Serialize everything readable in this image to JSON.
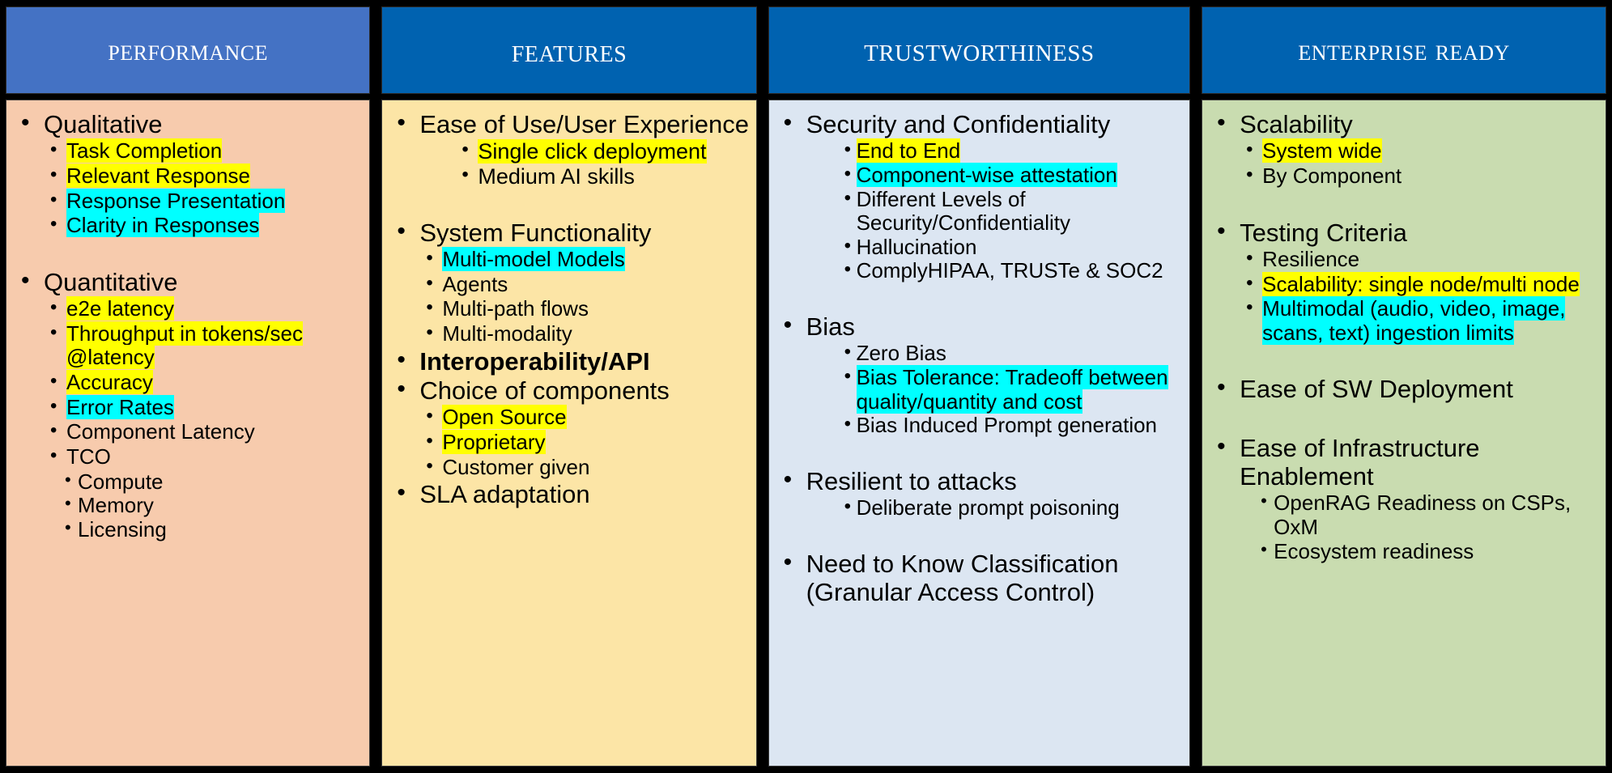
{
  "columns": [
    {
      "id": "performance",
      "title": "PERFORMANCE",
      "header_color": "#4472C4",
      "body_color": "#F7CBAD",
      "items": [
        {
          "level": 1,
          "text": "Qualitative",
          "highlight": "none"
        },
        {
          "level": 2,
          "text": "Task Completion",
          "highlight": "yellow"
        },
        {
          "level": 2,
          "text": " Relevant Response",
          "highlight": "yellow"
        },
        {
          "level": 2,
          "text": "Response  Presentation",
          "highlight": "cyan"
        },
        {
          "level": 2,
          "text": "Clarity in Responses",
          "highlight": "cyan"
        },
        {
          "level": 0,
          "text": "",
          "highlight": "none"
        },
        {
          "level": 1,
          "text": "Quantitative",
          "highlight": "none"
        },
        {
          "level": 2,
          "text": " e2e latency",
          "highlight": "yellow"
        },
        {
          "level": 2,
          "text": "Throughput in tokens/sec @latency",
          "highlight": "yellow"
        },
        {
          "level": 2,
          "text": "Accuracy",
          "highlight": "yellow"
        },
        {
          "level": 2,
          "text": "Error Rates",
          "highlight": "cyan"
        },
        {
          "level": 2,
          "text": "Component  Latency",
          "highlight": "none"
        },
        {
          "level": 2,
          "text": "TCO",
          "highlight": "none"
        },
        {
          "level": 3,
          "text": "Compute",
          "highlight": "none"
        },
        {
          "level": 3,
          "text": "Memory",
          "highlight": "none"
        },
        {
          "level": 3,
          "text": "Licensing",
          "highlight": "none"
        }
      ]
    },
    {
      "id": "features",
      "title": "FEATURES",
      "header_color": "#0062B0",
      "body_color": "#FCE5A6",
      "items": [
        {
          "level": 1,
          "text": "Ease of Use/User Experience",
          "highlight": "none"
        },
        {
          "level": 3,
          "text": "Single click deployment",
          "highlight": "yellow"
        },
        {
          "level": 3,
          "text": "Medium AI skills",
          "highlight": "none"
        },
        {
          "level": 0,
          "text": "",
          "highlight": "none"
        },
        {
          "level": 1,
          "text": "System Functionality",
          "highlight": "none"
        },
        {
          "level": 2,
          "text": "Multi-model Models",
          "highlight": "cyan"
        },
        {
          "level": 2,
          "text": "Agents",
          "highlight": "none"
        },
        {
          "level": 2,
          "text": "Multi-path flows",
          "highlight": "none"
        },
        {
          "level": 2,
          "text": "Multi-modality",
          "highlight": "none"
        },
        {
          "level": 1,
          "text": "Interoperability/API",
          "highlight": "none",
          "bold": true
        },
        {
          "level": 1,
          "text": "Choice of components",
          "highlight": "none"
        },
        {
          "level": 2,
          "text": "Open Source",
          "highlight": "yellow"
        },
        {
          "level": 2,
          "text": "Proprietary",
          "highlight": "yellow"
        },
        {
          "level": 2,
          "text": "Customer given",
          "highlight": "none"
        },
        {
          "level": 1,
          "text": "SLA adaptation",
          "highlight": "none"
        }
      ]
    },
    {
      "id": "trustworthiness",
      "title": "TRUSTWORTHINESS",
      "header_color": "#0062B0",
      "body_color": "#DCE6F2",
      "items": [
        {
          "level": 1,
          "text": "Security and Confidentiality",
          "highlight": "none"
        },
        {
          "level": 2,
          "text": "End to End",
          "highlight": "yellow"
        },
        {
          "level": 2,
          "text": "Component-wise  attestation",
          "highlight": "cyan"
        },
        {
          "level": 2,
          "text": "Different Levels of Security/Confidentiality",
          "highlight": "none"
        },
        {
          "level": 2,
          "text": "Hallucination",
          "highlight": "none"
        },
        {
          "level": 2,
          "text": "ComplyHIPAA, TRUSTe & SOC2",
          "highlight": "none"
        },
        {
          "level": 0,
          "text": "",
          "highlight": "none"
        },
        {
          "level": 1,
          "text": "Bias",
          "highlight": "none"
        },
        {
          "level": 2,
          "text": "Zero Bias",
          "highlight": "none"
        },
        {
          "level": 2,
          "text": "Bias Tolerance: Tradeoff between quality/quantity and cost",
          "highlight": "cyan"
        },
        {
          "level": 2,
          "text": "Bias Induced Prompt generation",
          "highlight": "none"
        },
        {
          "level": 0,
          "text": "",
          "highlight": "none"
        },
        {
          "level": 1,
          "text": "Resilient to attacks",
          "highlight": "none"
        },
        {
          "level": 2,
          "text": "Deliberate prompt poisoning",
          "highlight": "none"
        },
        {
          "level": 0,
          "text": "",
          "highlight": "none"
        },
        {
          "level": 1,
          "text": "Need to Know Classification (Granular Access Control)",
          "highlight": "none"
        }
      ]
    },
    {
      "id": "enterprise-ready",
      "title": "ENTERPRISE READY",
      "header_color": "#0062B0",
      "body_color": "#C9DCB0",
      "items": [
        {
          "level": 1,
          "text": "Scalability",
          "highlight": "none"
        },
        {
          "level": 2,
          "text": "System wide",
          "highlight": "yellow"
        },
        {
          "level": 2,
          "text": "By Component",
          "highlight": "none"
        },
        {
          "level": 0,
          "text": "",
          "highlight": "none"
        },
        {
          "level": 1,
          "text": "Testing Criteria",
          "highlight": "none"
        },
        {
          "level": 2,
          "text": "Resilience",
          "highlight": "none"
        },
        {
          "level": 2,
          "text": "Scalability: single node/multi node",
          "highlight": "yellow"
        },
        {
          "level": 2,
          "text": "Multimodal (audio, video, image, scans, text) ingestion limits",
          "highlight": "cyan"
        },
        {
          "level": 0,
          "text": "",
          "highlight": "none"
        },
        {
          "level": 1,
          "text": "Ease of SW Deployment",
          "highlight": "none"
        },
        {
          "level": 0,
          "text": "",
          "highlight": "none"
        },
        {
          "level": 1,
          "text": "Ease of Infrastructure Enablement",
          "highlight": "none"
        },
        {
          "level": 3,
          "text": "OpenRAG Readiness on CSPs, OxM",
          "highlight": "none"
        },
        {
          "level": 3,
          "text": "Ecosystem readiness",
          "highlight": "none"
        }
      ]
    }
  ],
  "col1": {
    "title": "PERFORMANCE",
    "i0": "Qualitative",
    "i1": "Task Completion",
    "i2": " Relevant Response",
    "i3": "Response  Presentation",
    "i4": "Clarity in Responses",
    "i5": "Quantitative",
    "i6": " e2e latency",
    "i7": "Throughput in tokens/sec @latency",
    "i8": "Accuracy",
    "i9": "Error Rates",
    "i10": "Component  Latency",
    "i11": "TCO",
    "i12": "Compute",
    "i13": "Memory",
    "i14": "Licensing"
  },
  "col2": {
    "title": "FEATURES",
    "i0": "Ease of Use/User Experience",
    "i1": "Single click deployment",
    "i2": "Medium AI skills",
    "i3": "System Functionality",
    "i4": "Multi-model Models",
    "i5": "Agents",
    "i6": "Multi-path flows",
    "i7": "Multi-modality",
    "i8": "Interoperability/API",
    "i9": "Choice of components",
    "i10": "Open Source",
    "i11": "Proprietary",
    "i12": "Customer given",
    "i13": "SLA adaptation"
  },
  "col3": {
    "title": "TRUSTWORTHINESS",
    "i0": "Security and Confidentiality",
    "i1": "End to End",
    "i2": "Component-wise  attestation",
    "i3": "Different Levels of Security/Confidentiality",
    "i4": "Hallucination",
    "i5": "ComplyHIPAA, TRUSTe & SOC2",
    "i6": "Bias",
    "i7": "Zero Bias",
    "i8": "Bias Tolerance: Tradeoff between quality/quantity and cost",
    "i9": "Bias Induced Prompt generation",
    "i10": "Resilient to attacks",
    "i11": "Deliberate prompt poisoning",
    "i12": "Need to Know Classification (Granular Access Control)"
  },
  "col4": {
    "title": "ENTERPRISE READY",
    "i0": "Scalability",
    "i1": "System wide",
    "i2": "By Component",
    "i3": "Testing Criteria",
    "i4": "Resilience",
    "i5": "Scalability: single node/multi node",
    "i6": "Multimodal (audio, video, image, scans, text) ingestion limits",
    "i7": "Ease of SW Deployment",
    "i8": "Ease of Infrastructure Enablement",
    "i9": "OpenRAG Readiness on CSPs, OxM",
    "i10": "Ecosystem readiness"
  }
}
